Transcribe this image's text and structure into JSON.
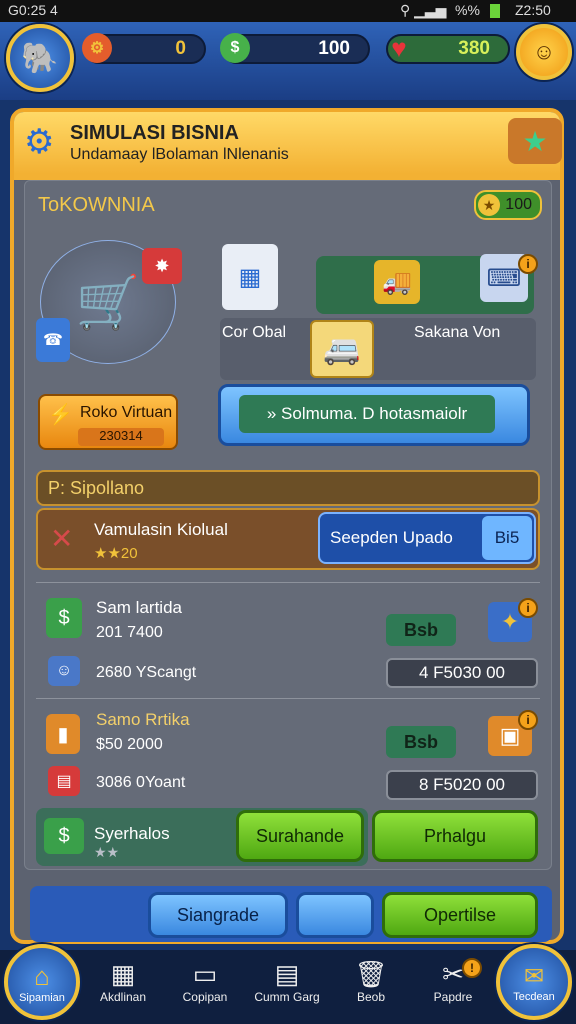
{
  "status_bar": {
    "time_left": "G0:25 4",
    "battery": "%%",
    "time_right": "Z2:50"
  },
  "top_bar": {
    "coins": "0",
    "cash": "100",
    "hearts": "380"
  },
  "header": {
    "title": "SIMULASI BISNIA",
    "subtitle": "Undamaay lBolaman lNlenanis"
  },
  "shop": {
    "name": "ToKOWNNIA",
    "currency_badge": "100",
    "virtual_label": "Roko Virtuan",
    "virtual_value": "230314",
    "card_left_label": "Cor Obal",
    "card_right_label": "Sakana Von",
    "action_label": "Solmuma. D hotasmaiolr"
  },
  "section": {
    "title": "P: Sipollano",
    "mission_label": "Vamulasin Kiolual",
    "mission_stars": "20",
    "update_button": "Seepden Upado",
    "update_count": "Bi5"
  },
  "items": [
    {
      "name": "Sam lartida",
      "price": "201 7400",
      "sub": "2680 YScangt",
      "tag": "Bsb",
      "cost": "4   F5030 00"
    },
    {
      "name": "Samo Rrtika",
      "price": "$50 2000",
      "sub": "3086 0Yoant",
      "tag": "Bsb",
      "cost": "8   F5020 00"
    }
  ],
  "bottom_row": {
    "label": "Syerhalos",
    "btn1": "Surahande",
    "btn2": "Prhalgu"
  },
  "footer_buttons": {
    "left": "Siangrade",
    "right": "Opertilse"
  },
  "nav": [
    "Sipamian",
    "Akdlinan",
    "Copipan",
    "Cumm Garg",
    "Beob",
    "Papdre",
    "Tecdean"
  ],
  "colors": {
    "accent": "#f0a92a",
    "panel": "#5c6270",
    "green": "#4fa812",
    "blue": "#3a88e0"
  }
}
